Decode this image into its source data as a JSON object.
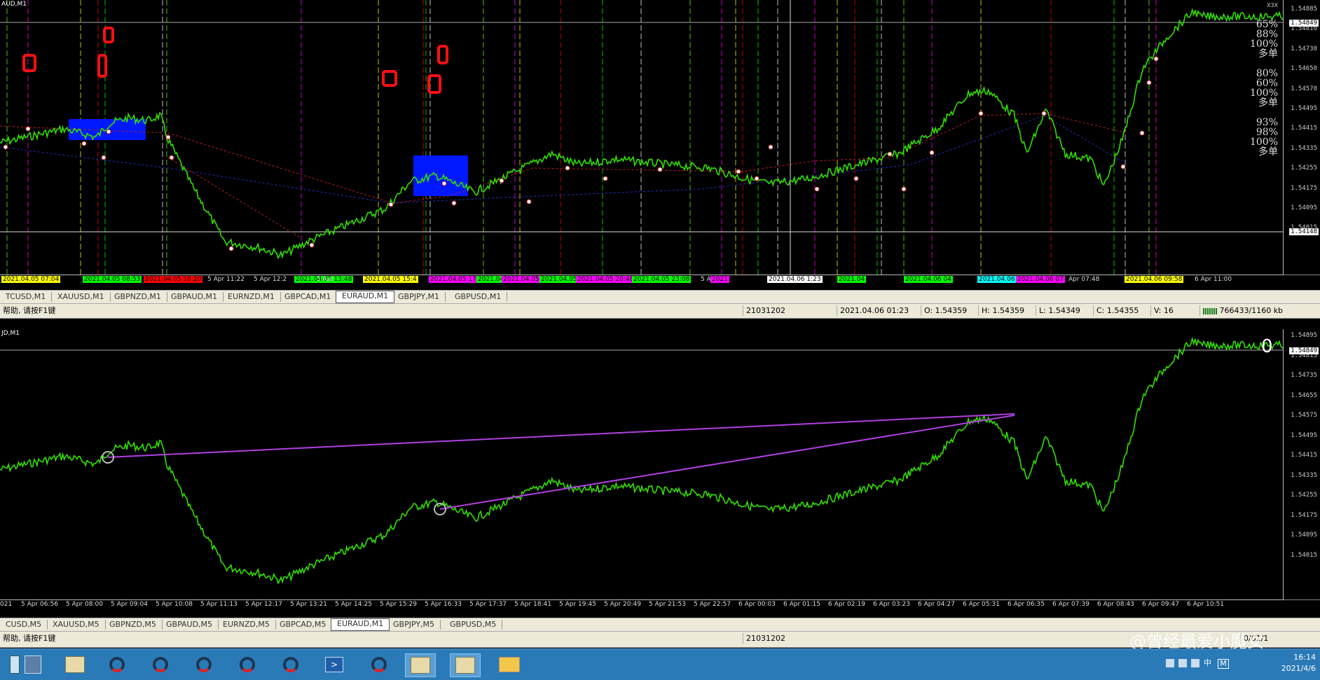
{
  "top_chart": {
    "title": "AUD,M1",
    "corner_label": "X3X",
    "price_labels": [
      "1.54885",
      "1.54810",
      "1.54730",
      "1.54650",
      "1.54570",
      "1.54495",
      "1.54415",
      "1.54335",
      "1.54255",
      "1.54175",
      "1.54095",
      "1.54015"
    ],
    "current_price": "1.54849",
    "cursor_price": "1.54148",
    "pct_blocks": [
      [
        "65%",
        "88%",
        "100%",
        "多单"
      ],
      [
        "80%",
        "60%",
        "100%",
        "多单"
      ],
      [
        "93%",
        "98%",
        "100%",
        "多单"
      ]
    ],
    "time_labels": [
      {
        "text": "5 Apr 11:22"
      },
      {
        "text": "5 Apr 12:2"
      },
      {
        "text": "5 Apr"
      },
      {
        "text": "5 A"
      },
      {
        "text": "Apr 07:48"
      },
      {
        "text": "6 Apr 11:00"
      }
    ],
    "time_tags": [
      {
        "text": "2021.04.05 07:04",
        "color": "#ffff00"
      },
      {
        "text": "2021.04.05 08:53",
        "color": "#00ff00"
      },
      {
        "text": "2021.04.05 10:20",
        "color": "#ff0000"
      },
      {
        "text": "2021.04.05 13:48",
        "color": "#00ff00"
      },
      {
        "text": "2021.04.05 15:4",
        "color": "#ffff00"
      },
      {
        "text": "2021.04.05 17",
        "color": "#ff00ff"
      },
      {
        "text": "2021.04",
        "color": "#00ff00"
      },
      {
        "text": "2021.04.05",
        "color": "#ff00ff"
      },
      {
        "text": "2021.04.05",
        "color": "#00ff00"
      },
      {
        "text": "2021.04.05 20:48",
        "color": "#ff00ff"
      },
      {
        "text": "2021.04.05 23:08",
        "color": "#00ff00"
      },
      {
        "text": "2021",
        "color": "#ff00ff"
      },
      {
        "text": "2021.04.06 1:23",
        "color": "#ffffff"
      },
      {
        "text": "2021.04",
        "color": "#00ff00"
      },
      {
        "text": "2021.04.06 04",
        "color": "#00ff00"
      },
      {
        "text": "2021.04.06 05:52",
        "color": "#00ffff"
      },
      {
        "text": "2021.04.06 07",
        "color": "#ff00ff"
      },
      {
        "text": "2021.04.06 09:58",
        "color": "#ffff00"
      }
    ]
  },
  "top_tabs": [
    "TCUSD,M1",
    "XAUUSD,M1",
    "GBPNZD,M1",
    "GBPAUD,M1",
    "EURNZD,M1",
    "GBPCAD,M1",
    "EURAUD,M1",
    "GBPJPY,M1",
    "GBPUSD,M1"
  ],
  "top_tabs_active": "EURAUD,M1",
  "top_status": {
    "help": "帮助, 请按F1键",
    "profile": "21031202",
    "datetime": "2021.04.06 01:23",
    "open": "O: 1.54359",
    "high": "H: 1.54359",
    "low": "L: 1.54349",
    "close": "C: 1.54355",
    "volume": "V: 16",
    "traffic": "766433/1160 kb"
  },
  "bottom_chart": {
    "title": "JD,M1",
    "price_labels": [
      "1.54895",
      "1.54815",
      "1.54735",
      "1.54655",
      "1.54575",
      "1.54495",
      "1.54415",
      "1.54335",
      "1.54255",
      "1.54175",
      "1.54095",
      "1.54015"
    ],
    "current_price": "1.54849",
    "zero_mark": "0",
    "time_labels": [
      "021",
      "5 Apr 06:56",
      "5 Apr 08:00",
      "5 Apr 09:04",
      "5 Apr 10:08",
      "5 Apr 11:13",
      "5 Apr 12:17",
      "5 Apr 13:21",
      "5 Apr 14:25",
      "5 Apr 15:29",
      "5 Apr 16:33",
      "5 Apr 17:37",
      "5 Apr 18:41",
      "5 Apr 19:45",
      "5 Apr 20:49",
      "5 Apr 21:53",
      "5 Apr 22:57",
      "6 Apr 00:03",
      "6 Apr 01:15",
      "6 Apr 02:19",
      "6 Apr 03:23",
      "6 Apr 04:27",
      "6 Apr 05:31",
      "6 Apr 06:35",
      "6 Apr 07:39",
      "6 Apr 08:43",
      "6 Apr 09:47",
      "6 Apr 10:51"
    ]
  },
  "bottom_tabs": [
    "CUSD,M5",
    "XAUUSD,M5",
    "GBPNZD,M5",
    "GBPAUD,M5",
    "EURNZD,M5",
    "GBPCAD,M5",
    "EURAUD,M1",
    "GBPJPY,M5",
    "GBPUSD,M5"
  ],
  "bottom_tabs_active": "EURAUD,M1",
  "bottom_status": {
    "help": "帮助, 请按F1键",
    "profile": "21031202",
    "traffic": "0/61/1"
  },
  "taskbar": {
    "time": "16:14",
    "date": "2021/4/6",
    "lang": "M"
  },
  "watermark": "@曾经最爱小魔女",
  "colors": {
    "price_line": "#32e000",
    "trend_line": "#b040e0",
    "blue_box": "#0018ff",
    "red_marker": "#ff1010"
  }
}
